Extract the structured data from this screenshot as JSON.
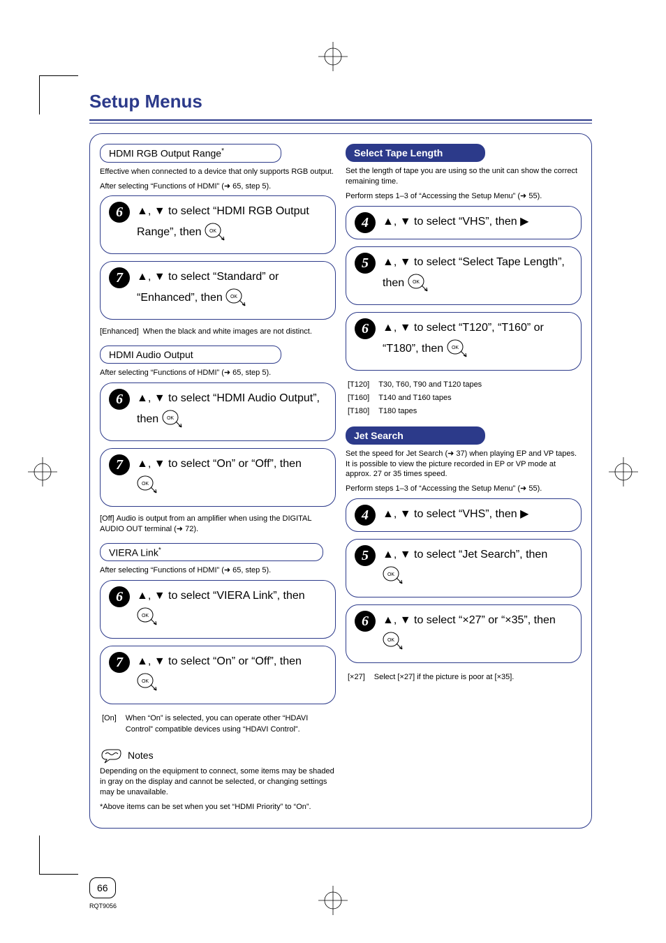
{
  "page": {
    "title": "Setup Menus",
    "pageNumber": "66",
    "footerCode": "RQT9056"
  },
  "left": {
    "hdmiRgb": {
      "heading": "HDMI RGB Output Range",
      "headingNote": "*",
      "desc1": "Effective when connected to a device that only supports RGB output.",
      "desc2": "After selecting “Functions of HDMI” (➜ 65, step 5).",
      "step6": "▲, ▼ to select “HDMI RGB Output Range”, then ",
      "step7": "▲, ▼ to select “Standard” or “Enhanced”, then ",
      "enhancedLabel": "[Enhanced]",
      "enhancedText": "When the black and white images are not distinct."
    },
    "hdmiAudio": {
      "heading": "HDMI Audio Output",
      "desc": "After selecting “Functions of HDMI” (➜ 65, step 5).",
      "step6": "▲, ▼ to select “HDMI Audio Output”, then ",
      "step7": "▲, ▼ to select “On” or “Off”, then ",
      "offLabel": "[Off]",
      "offText": "Audio is output from an amplifier when using the DIGITAL AUDIO OUT terminal (➜ 72)."
    },
    "vieraLink": {
      "heading": "VIERA Link",
      "headingNote": "*",
      "desc": "After selecting “Functions of HDMI” (➜ 65, step 5).",
      "step6": "▲, ▼ to select “VIERA Link”, then ",
      "step7": "▲, ▼ to select “On” or “Off”, then ",
      "onLabel": "[On]",
      "onText": "When “On” is selected, you can operate other “HDAVI Control” compatible devices using “HDAVI Control”."
    },
    "notes": {
      "label": "Notes",
      "body1": "Depending on the equipment to connect, some items may be shaded in gray on the display and cannot be selected, or changing settings may be unavailable.",
      "body2": "*Above items can be set when you set “HDMI Priority” to “On”."
    }
  },
  "right": {
    "tapeLength": {
      "heading": "Select Tape Length",
      "desc1": "Set the length of tape you are using so the unit can show the correct remaining time.",
      "desc2": "Perform steps 1–3 of “Accessing the Setup Menu” (➜ 55).",
      "step4": "▲, ▼ to select “VHS”, then ▶",
      "step5": "▲, ▼ to select “Select Tape Length”, then ",
      "step6": "▲, ▼ to select “T120”, “T160” or “T180”, then ",
      "t120Label": "[T120]",
      "t120Text": "T30, T60, T90 and T120 tapes",
      "t160Label": "[T160]",
      "t160Text": "T140 and T160 tapes",
      "t180Label": "[T180]",
      "t180Text": "T180 tapes"
    },
    "jetSearch": {
      "heading": "Jet Search",
      "desc1": "Set the speed for Jet Search (➜ 37) when playing EP and VP tapes. It is possible to view the picture recorded in EP or VP mode at approx. 27 or 35 times speed.",
      "desc2": "Perform steps 1–3 of “Accessing the Setup Menu” (➜ 55).",
      "step4": "▲, ▼ to select “VHS”, then ▶",
      "step5": "▲, ▼ to select “Jet Search”, then ",
      "step6": "▲, ▼ to select “×27” or “×35”, then ",
      "x27Label": "[×27]",
      "x27Text": "Select [×27] if the picture is poor at [×35]."
    }
  }
}
